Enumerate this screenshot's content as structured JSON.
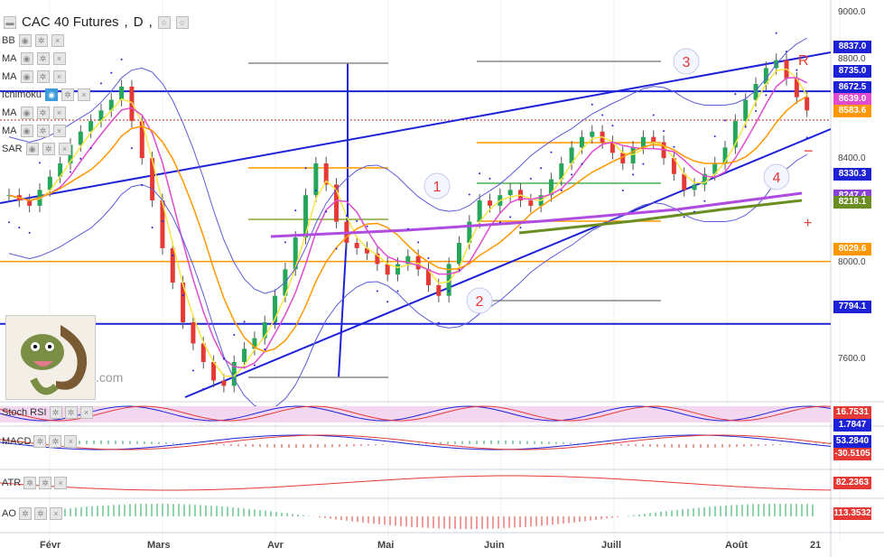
{
  "title": {
    "symbol": "CAC 40 Futures",
    "interval": "D"
  },
  "indicators": [
    {
      "label": "BB"
    },
    {
      "label": "MA"
    },
    {
      "label": "MA"
    },
    {
      "label": "Ichimoku"
    },
    {
      "label": "MA"
    },
    {
      "label": "MA"
    },
    {
      "label": "SAR"
    }
  ],
  "price_axis": {
    "ticks": [
      "9000.0",
      "8800.0",
      "8400.0",
      "8000.0",
      "7600.0"
    ]
  },
  "price_labels": [
    {
      "text": "8837.0",
      "color": "#1e22d6"
    },
    {
      "text": "8735.0",
      "color": "#1e22d6"
    },
    {
      "text": "8672.5",
      "color": "#1e22d6"
    },
    {
      "text": "8639.0",
      "color": "#e04bd0"
    },
    {
      "text": "8583.6",
      "color": "#ff9800"
    },
    {
      "text": "8330.3",
      "color": "#1e22d6"
    },
    {
      "text": "8247.4",
      "color": "#8a3fd6"
    },
    {
      "text": "8218.1",
      "color": "#6b8e23"
    },
    {
      "text": "8029.6",
      "color": "#ff9800"
    },
    {
      "text": "7794.1",
      "color": "#1e22d6"
    }
  ],
  "annotations": [
    "1",
    "2",
    "3",
    "4",
    "R",
    "−",
    "+"
  ],
  "subpanes": [
    {
      "label": "Stoch RSI",
      "values": [
        "16.7531",
        "1.7847"
      ]
    },
    {
      "label": "MACD",
      "values": [
        "53.2840",
        "-30.5105"
      ]
    },
    {
      "label": "ATR",
      "values": [
        "82.2363"
      ]
    },
    {
      "label": "AO",
      "values": [
        "113.3532"
      ]
    }
  ],
  "date_axis": [
    "Févr",
    "Mars",
    "Avr",
    "Mai",
    "Juin",
    "Juill",
    "Août",
    "21"
  ],
  "logo_text": ".com",
  "chart_data": {
    "type": "candlestick",
    "title": "CAC 40 Futures, D",
    "ylim": [
      7500,
      9000
    ],
    "x_labels": [
      "Févr",
      "Mars",
      "Avr",
      "Mai",
      "Juin",
      "Juill",
      "Août",
      "21"
    ],
    "closes": [
      8280,
      8260,
      8240,
      8300,
      8350,
      8400,
      8470,
      8520,
      8560,
      8600,
      8640,
      8690,
      8560,
      8420,
      8260,
      8080,
      7950,
      7800,
      7720,
      7650,
      7580,
      7560,
      7650,
      7700,
      7740,
      7800,
      7900,
      8000,
      8120,
      8280,
      8400,
      8320,
      8180,
      8100,
      8080,
      8060,
      8020,
      7980,
      8020,
      8050,
      8000,
      7940,
      7900,
      8020,
      8100,
      8180,
      8260,
      8240,
      8280,
      8300,
      8260,
      8240,
      8280,
      8340,
      8400,
      8460,
      8500,
      8520,
      8480,
      8440,
      8400,
      8460,
      8500,
      8480,
      8420,
      8360,
      8300,
      8320,
      8360,
      8400,
      8460,
      8560,
      8640,
      8700,
      8760,
      8790,
      8720,
      8650,
      8600
    ],
    "support_levels": [
      8837.0,
      8735.0,
      8672.5,
      8029.6,
      7794.1
    ]
  }
}
